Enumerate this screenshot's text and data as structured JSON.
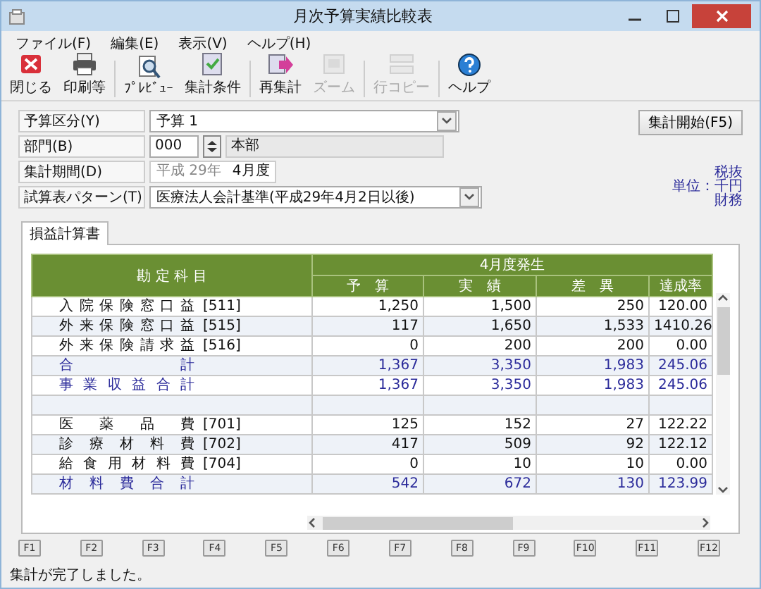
{
  "window": {
    "title": "月次予算実績比較表"
  },
  "menu": [
    "ファイル(F)",
    "編集(E)",
    "表示(V)",
    "ヘルプ(H)"
  ],
  "toolbar": [
    {
      "label": "閉じる",
      "disabled": false
    },
    {
      "label": "印刷等",
      "disabled": false
    },
    {
      "label": "ﾌﾟﾚﾋﾞｭｰ",
      "disabled": false
    },
    {
      "label": "集計条件",
      "disabled": false
    },
    {
      "label": "再集計",
      "disabled": false
    },
    {
      "label": "ズーム",
      "disabled": true
    },
    {
      "label": "行コピー",
      "disabled": true
    },
    {
      "label": "ヘルプ",
      "disabled": false
    }
  ],
  "form": {
    "budget_type": {
      "label": "予算区分(Y)",
      "value": "予算 1"
    },
    "department": {
      "label": "部門(B)",
      "code": "000",
      "name": "本部"
    },
    "period": {
      "label": "集計期間(D)",
      "era": "平成 29年",
      "month": "4月度"
    },
    "pattern": {
      "label": "試算表パターン(T)",
      "value": "医療法人会計基準(平成29年4月2日以後)"
    },
    "start_button": "集計開始(F5)",
    "notes": [
      "税抜",
      "単位：千円",
      "財務"
    ]
  },
  "tabs": [
    {
      "label": "損益計算書",
      "selected": true
    }
  ],
  "table": {
    "account_header": "勘 定 科 目",
    "group_header": "4月度発生",
    "columns": [
      "予　算",
      "実　績",
      "差　異",
      "達成率"
    ],
    "rows": [
      {
        "kind": "account",
        "name": "入院保険窓口益",
        "code": "[511]",
        "values": [
          "1,250",
          "1,500",
          "250",
          "120.00"
        ]
      },
      {
        "kind": "account",
        "name": "外来保険窓口益",
        "code": "[515]",
        "values": [
          "117",
          "1,650",
          "1,533",
          "1410.26"
        ]
      },
      {
        "kind": "account",
        "name": "外来保険請求益",
        "code": "[516]",
        "values": [
          "0",
          "200",
          "200",
          "0.00"
        ]
      },
      {
        "kind": "total",
        "name": "合計",
        "values": [
          "1,367",
          "3,350",
          "1,983",
          "245.06"
        ]
      },
      {
        "kind": "total",
        "name": "事業収益合計",
        "values": [
          "1,367",
          "3,350",
          "1,983",
          "245.06"
        ]
      },
      {
        "kind": "blank"
      },
      {
        "kind": "account",
        "name": "医薬品費",
        "code": "[701]",
        "values": [
          "125",
          "152",
          "27",
          "122.22"
        ]
      },
      {
        "kind": "account",
        "name": "診療材料費",
        "code": "[702]",
        "values": [
          "417",
          "509",
          "92",
          "122.12"
        ]
      },
      {
        "kind": "account",
        "name": "給食用材料費",
        "code": "[704]",
        "values": [
          "0",
          "10",
          "10",
          "0.00"
        ]
      },
      {
        "kind": "total",
        "name": "材料費合計",
        "values": [
          "542",
          "672",
          "130",
          "123.99"
        ]
      }
    ]
  },
  "function_keys": [
    "F1",
    "F2",
    "F3",
    "F4",
    "F5",
    "F6",
    "F7",
    "F8",
    "F9",
    "F10",
    "F11",
    "F12"
  ],
  "status_bar": "集計が完了しました。"
}
